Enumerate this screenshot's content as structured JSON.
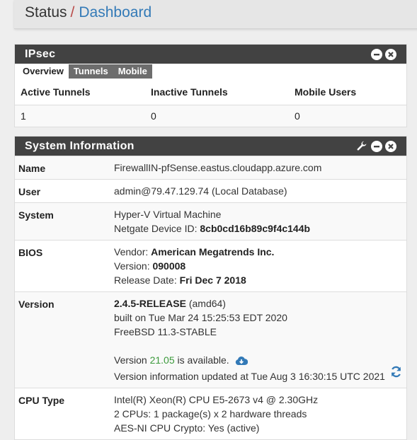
{
  "breadcrumb": {
    "status": "Status",
    "separator": "/",
    "dashboard": "Dashboard"
  },
  "ipsec": {
    "title": "IPsec",
    "tabs": [
      "Overview",
      "Tunnels",
      "Mobile"
    ],
    "columns": [
      "Active Tunnels",
      "Inactive Tunnels",
      "Mobile Users"
    ],
    "row": [
      "1",
      "0",
      "0"
    ]
  },
  "sysinfo": {
    "title": "System Information",
    "name_label": "Name",
    "name_value": "FirewallIN-pfSense.eastus.cloudapp.azure.com",
    "user_label": "User",
    "user_value": "admin@79.47.129.74 (Local Database)",
    "system_label": "System",
    "system_line1": "Hyper-V Virtual Machine",
    "system_line2_prefix": "Netgate Device ID: ",
    "system_device_id": "8cb0cd16b89c9f4c144b",
    "bios_label": "BIOS",
    "bios_vendor_prefix": "Vendor: ",
    "bios_vendor": "American Megatrends Inc.",
    "bios_version_prefix": "Version: ",
    "bios_version": "090008",
    "bios_date_prefix": "Release Date: ",
    "bios_date": "Fri Dec 7 2018",
    "version_label": "Version",
    "version_release": "2.4.5-RELEASE",
    "version_arch": " (amd64)",
    "version_built": "built on Tue Mar 24 15:25:53 EDT 2020",
    "version_os": "FreeBSD 11.3-STABLE",
    "version_avail_prefix": "Version ",
    "version_avail_number": "21.05",
    "version_avail_suffix": " is available.",
    "version_updated": "Version information updated at Tue Aug 3 16:30:15 UTC 2021",
    "cpu_label": "CPU Type",
    "cpu_line1": "Intel(R) Xeon(R) CPU E5-2673 v4 @ 2.30GHz",
    "cpu_line2": "2 CPUs: 1 package(s) x 2 hardware threads",
    "cpu_line3": "AES-NI CPU Crypto: Yes (active)"
  },
  "icons": [
    "minimize-icon",
    "close-icon",
    "wrench-icon",
    "cloud-download-icon",
    "refresh-icon"
  ],
  "colors": {
    "panel_heading": "#424242",
    "link": "#337ab7",
    "accent_red": "#b94a48",
    "green": "#3c9a3c",
    "info_blue": "#337ab7"
  }
}
